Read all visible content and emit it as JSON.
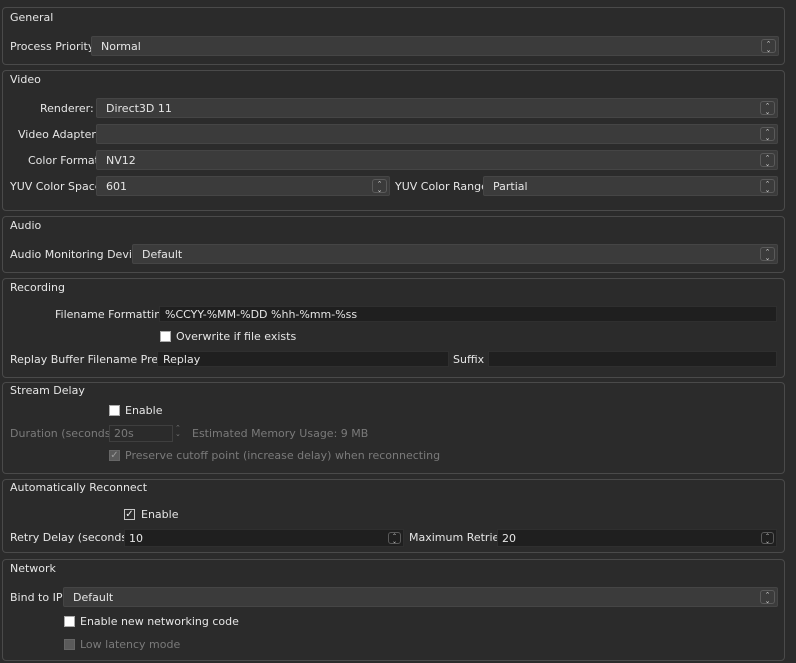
{
  "general": {
    "title": "General",
    "process_priority_label": "Process Priority",
    "process_priority_value": "Normal"
  },
  "video": {
    "title": "Video",
    "renderer_label": "Renderer:",
    "renderer_value": "Direct3D 11",
    "adapter_label": "Video Adapter:",
    "adapter_value": "",
    "color_format_label": "Color Format",
    "color_format_value": "NV12",
    "yuv_space_label": "YUV Color Space",
    "yuv_space_value": "601",
    "yuv_range_label": "YUV Color Range",
    "yuv_range_value": "Partial"
  },
  "audio": {
    "title": "Audio",
    "monitoring_label": "Audio Monitoring Device",
    "monitoring_value": "Default"
  },
  "recording": {
    "title": "Recording",
    "filename_label": "Filename Formatting",
    "filename_value": "%CCYY-%MM-%DD %hh-%mm-%ss",
    "overwrite_label": "Overwrite if file exists",
    "overwrite_checked": false,
    "replay_prefix_label": "Replay Buffer Filename Prefix",
    "replay_prefix_value": "Replay",
    "suffix_label": "Suffix",
    "suffix_value": ""
  },
  "stream_delay": {
    "title": "Stream Delay",
    "enable_label": "Enable",
    "enable_checked": false,
    "duration_label": "Duration (seconds)",
    "duration_value": "20s",
    "memory_usage": "Estimated Memory Usage: 9 MB",
    "preserve_label": "Preserve cutoff point (increase delay) when reconnecting",
    "preserve_checked": true
  },
  "reconnect": {
    "title": "Automatically Reconnect",
    "enable_label": "Enable",
    "enable_checked": true,
    "retry_delay_label": "Retry Delay (seconds)",
    "retry_delay_value": "10",
    "max_retries_label": "Maximum Retries",
    "max_retries_value": "20"
  },
  "network": {
    "title": "Network",
    "bind_label": "Bind to IP",
    "bind_value": "Default",
    "new_code_label": "Enable new networking code",
    "new_code_checked": false,
    "low_latency_label": "Low latency mode",
    "low_latency_checked": false
  },
  "icons": {
    "combo_arrows": "updown-chevron-icon",
    "spin_arrows": "spin-arrows-icon",
    "checkmark": "checkmark-icon"
  }
}
